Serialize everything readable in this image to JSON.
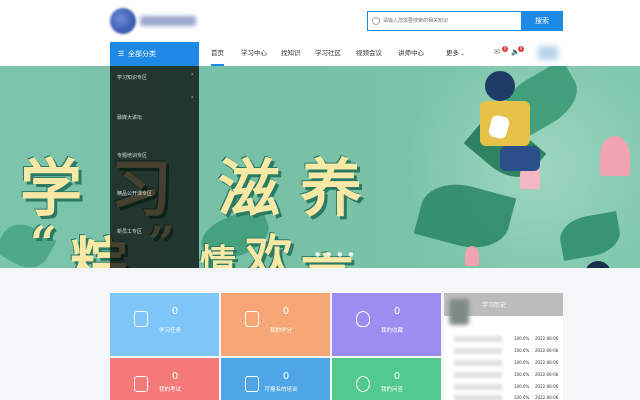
{
  "search": {
    "placeholder": "请输入您需要搜索的相关知识",
    "button": "搜索"
  },
  "nav": {
    "all_categories": "全部分类",
    "items": [
      "首页",
      "学习中心",
      "找知识",
      "学习社区",
      "视频会议",
      "讲师中心",
      "更多"
    ],
    "active": "首页",
    "badges": [
      "0",
      "0"
    ]
  },
  "sidebar": {
    "items": [
      "学习知识专区",
      "融媒大讲坛",
      "专题培训专区",
      "精品公开课专区",
      "新员工专区"
    ]
  },
  "banner": {
    "headline_row1": [
      "学",
      "习",
      "滋",
      "养"
    ],
    "headline_row2": [
      "“",
      "粽",
      "”",
      "情",
      "欢",
      "享"
    ],
    "dots": "● ● ● ●"
  },
  "cards": [
    {
      "value": "0",
      "label": "学习任务",
      "color": "#7ec6f7",
      "icon": "task-icon"
    },
    {
      "value": "0",
      "label": "我的学分",
      "color": "#f7a777",
      "icon": "credit-icon"
    },
    {
      "value": "0",
      "label": "我的收藏",
      "color": "#9b8ef0",
      "icon": "heart-icon"
    },
    {
      "value": "0",
      "label": "我的考试",
      "color": "#f47a7a",
      "icon": "pen-icon"
    },
    {
      "value": "0",
      "label": "可报名的培训",
      "color": "#4ea6e6",
      "icon": "edit-icon"
    },
    {
      "value": "0",
      "label": "我的问答",
      "color": "#52c98f",
      "icon": "question-icon"
    }
  ],
  "history": {
    "title": "学习历史",
    "rows": [
      {
        "progress": "100.0%",
        "date": "2022-06-06"
      },
      {
        "progress": "100.0%",
        "date": "2022-06-06"
      },
      {
        "progress": "100.0%",
        "date": "2022-06-06"
      },
      {
        "progress": "100.0%",
        "date": "2022-06-06"
      },
      {
        "progress": "100.0%",
        "date": "2022-06-06"
      },
      {
        "progress": "100.0%",
        "date": "2022-06-06"
      }
    ]
  }
}
